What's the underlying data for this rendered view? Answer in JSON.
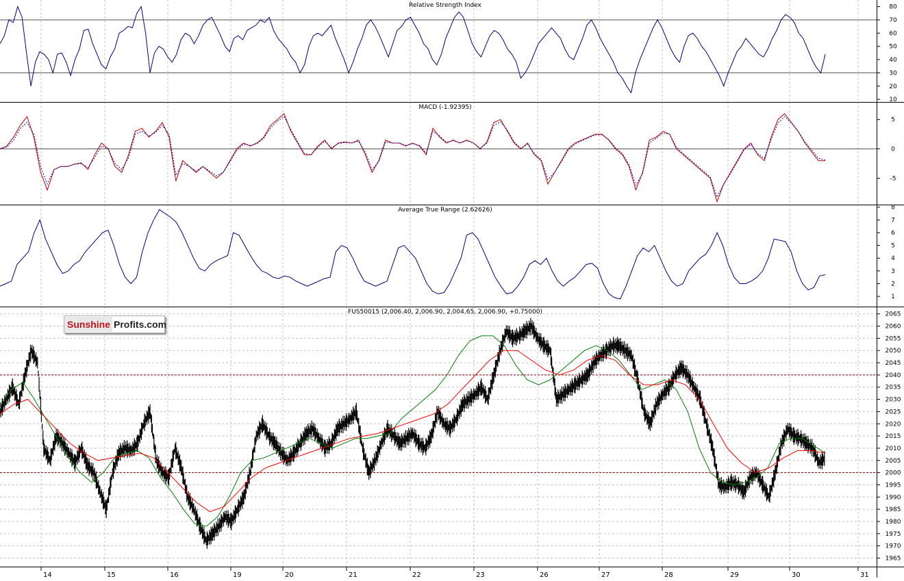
{
  "colors": {
    "rsi_line": "#000080",
    "macd_line": "#c00000",
    "signal_line": "#0000c0",
    "atr_line": "#000080",
    "price_bars": "#000000",
    "ma_fast": "#008000",
    "ma_slow": "#ff0000",
    "level_lines": "#800000",
    "grid": "#c0c0c0"
  },
  "logo": {
    "part1": "Sunshine",
    "part2": "Profits.com"
  },
  "x_axis": {
    "labels": [
      "14",
      "15",
      "16",
      "19",
      "20",
      "21",
      "22",
      "23",
      "26",
      "27",
      "28",
      "29",
      "30",
      "31"
    ]
  },
  "chart_data": [
    {
      "type": "line",
      "title": "Relative Strength Index",
      "ylim": [
        8,
        85
      ],
      "y_ticks": [
        80,
        70,
        60,
        50,
        40,
        30,
        20,
        10
      ],
      "reference_levels": [
        70,
        30
      ],
      "grid": true,
      "series": [
        {
          "key": "rsi",
          "style": "solid",
          "values": [
            52,
            58,
            70,
            68,
            80,
            72,
            45,
            20,
            38,
            46,
            44,
            40,
            30,
            44,
            45,
            38,
            28,
            40,
            48,
            62,
            63,
            52,
            44,
            36,
            33,
            42,
            48,
            60,
            62,
            65,
            64,
            75,
            80,
            60,
            30,
            45,
            50,
            48,
            42,
            38,
            44,
            55,
            60,
            58,
            52,
            58,
            66,
            70,
            72,
            65,
            58,
            50,
            46,
            56,
            58,
            55,
            62,
            64,
            66,
            70,
            68,
            72,
            62,
            56,
            52,
            48,
            42,
            38,
            30,
            36,
            50,
            58,
            60,
            58,
            62,
            66,
            56,
            48,
            40,
            30,
            38,
            48,
            56,
            66,
            70,
            65,
            58,
            50,
            42,
            52,
            62,
            65,
            70,
            72,
            66,
            60,
            52,
            48,
            40,
            36,
            44,
            56,
            64,
            72,
            76,
            72,
            62,
            52,
            46,
            42,
            50,
            58,
            62,
            60,
            55,
            48,
            44,
            38,
            26,
            30,
            36,
            44,
            52,
            56,
            60,
            64,
            60,
            56,
            48,
            42,
            40,
            48,
            56,
            66,
            70,
            64,
            56,
            50,
            44,
            38,
            30,
            26,
            20,
            15,
            30,
            40,
            48,
            56,
            64,
            70,
            64,
            56,
            48,
            42,
            38,
            50,
            58,
            60,
            56,
            50,
            46,
            40,
            34,
            28,
            20,
            30,
            38,
            46,
            50,
            56,
            52,
            48,
            44,
            42,
            48,
            56,
            62,
            70,
            74,
            72,
            68,
            60,
            56,
            48,
            40,
            34,
            30,
            44
          ]
        }
      ]
    },
    {
      "type": "line",
      "title": "MACD (-1.92395)",
      "ylim": [
        -9.5,
        8
      ],
      "y_ticks": [
        5,
        0,
        -5
      ],
      "reference_levels": [
        0
      ],
      "grid": true,
      "series": [
        {
          "key": "macd",
          "style": "solid",
          "values": [
            0,
            0.5,
            2,
            4,
            5.5,
            2,
            -4,
            -7,
            -3.5,
            -3,
            -3,
            -2.6,
            -2.4,
            -3.5,
            -1,
            1,
            0,
            -3,
            -4,
            -1,
            3,
            3.5,
            2,
            3,
            4.5,
            2,
            -5.5,
            -2,
            -3,
            -4,
            -3,
            -4,
            -5,
            -4,
            -2,
            0,
            1,
            0.5,
            1,
            2,
            4,
            5,
            6,
            3,
            1,
            -1,
            -1,
            0.5,
            1.5,
            0,
            1,
            1.2,
            1,
            1.5,
            -1,
            -4,
            -2,
            1.5,
            1,
            1,
            0.5,
            1,
            0.5,
            -1,
            3.5,
            2,
            1,
            1.5,
            1,
            1.5,
            1,
            0,
            1.2,
            4.5,
            5,
            3,
            1,
            0,
            1,
            -1,
            -2,
            -6,
            -4,
            -2,
            0,
            1,
            1.5,
            2,
            2.5,
            2.5,
            1.5,
            0,
            -1,
            -3,
            -7,
            -4,
            1.5,
            2,
            3,
            2.5,
            0,
            -1,
            -2,
            -3,
            -4,
            -5,
            -9,
            -6,
            -4,
            -2,
            0,
            1,
            -1,
            -2,
            2,
            5,
            6,
            4.5,
            3,
            1,
            -0.5,
            -2,
            -2
          ]
        },
        {
          "key": "signal",
          "style": "dashed",
          "values": [
            0,
            0.3,
            1.5,
            3.5,
            4.5,
            2.5,
            -3,
            -6,
            -3.5,
            -3,
            -3,
            -2.6,
            -2.5,
            -3.2,
            -1.5,
            0.5,
            0,
            -2.5,
            -3.5,
            -1.5,
            2.5,
            3,
            2.2,
            2.8,
            4,
            2.5,
            -4.5,
            -2.5,
            -3,
            -3.8,
            -3,
            -3.8,
            -4.6,
            -4,
            -2.2,
            -0.2,
            0.8,
            0.6,
            0.9,
            1.8,
            3.6,
            4.7,
            5.5,
            3.3,
            1.2,
            -0.8,
            -1,
            0.3,
            1.3,
            0.2,
            0.9,
            1.1,
            1,
            1.3,
            -0.6,
            -3.5,
            -2.2,
            1.2,
            1,
            1,
            0.6,
            0.9,
            0.6,
            -0.7,
            3,
            2.2,
            1.1,
            1.4,
            1,
            1.4,
            1,
            0.1,
            1,
            4,
            4.6,
            3.2,
            1.2,
            0.1,
            0.8,
            -0.8,
            -1.8,
            -5.2,
            -4,
            -2.2,
            -0.2,
            0.8,
            1.4,
            1.9,
            2.4,
            2.4,
            1.6,
            0.2,
            -0.8,
            -2.7,
            -6.2,
            -4.2,
            1,
            1.8,
            2.7,
            2.5,
            0.3,
            -0.8,
            -1.8,
            -2.8,
            -3.8,
            -4.8,
            -8.2,
            -6,
            -4.2,
            -2.2,
            -0.2,
            0.8,
            -0.8,
            -1.6,
            1.6,
            4.4,
            5.5,
            4.4,
            3,
            1.2,
            -0.2,
            -1.6,
            -1.9
          ]
        }
      ]
    },
    {
      "type": "line",
      "title": "Average True Range (2.62626)",
      "ylim": [
        0.2,
        8.2
      ],
      "y_ticks": [
        8,
        7,
        6,
        5,
        4,
        3,
        2,
        1
      ],
      "grid": true,
      "series": [
        {
          "key": "atr",
          "style": "solid",
          "values": [
            1.8,
            2,
            2.2,
            3.5,
            4,
            4.5,
            6,
            7,
            5.5,
            4.5,
            3.5,
            2.8,
            3,
            3.5,
            3.8,
            4.5,
            5,
            5.5,
            6,
            6.2,
            5,
            3.5,
            2.5,
            2,
            2.5,
            4.5,
            6,
            7,
            7.8,
            7.5,
            7.2,
            6.8,
            6,
            5,
            4,
            3.2,
            3,
            3.5,
            3.8,
            4,
            4.2,
            6,
            5.8,
            5,
            4.2,
            3.5,
            3,
            2.8,
            2.5,
            2.4,
            2.6,
            2.5,
            2.2,
            2,
            1.8,
            2,
            2.2,
            2.4,
            2.5,
            4.5,
            5,
            4.8,
            4,
            3,
            2.2,
            2,
            1.8,
            2,
            2.2,
            3.5,
            4.8,
            5,
            4.5,
            4,
            3,
            2,
            1.4,
            1.2,
            1.3,
            2,
            3,
            4,
            5.8,
            6,
            5.5,
            4.5,
            3.5,
            2.5,
            1.8,
            1.2,
            1.3,
            1.8,
            2.5,
            3.5,
            3.8,
            3.5,
            4,
            3,
            2.2,
            1.8,
            2.2,
            2.5,
            3,
            3.5,
            3.6,
            3.2,
            2,
            1.2,
            0.9,
            0.8,
            1.8,
            3,
            4.2,
            4.8,
            4.5,
            5,
            4,
            3,
            2.2,
            1.8,
            2,
            3,
            3.5,
            4,
            4.3,
            5,
            6,
            5,
            3.5,
            2.5,
            2,
            2,
            2.2,
            2.5,
            3,
            4,
            5.5,
            5.4,
            5.3,
            4.5,
            3,
            2,
            1.5,
            1.7,
            2.6,
            2.7
          ]
        }
      ]
    },
    {
      "type": "line",
      "title": "FUS50015 (2,006.40, 2,006.90, 2,004.65, 2,006.90, +0.75000)",
      "ylim": [
        1961.5,
        2068
      ],
      "y_ticks": [
        2065,
        2060,
        2055,
        2050,
        2045,
        2040,
        2035,
        2030,
        2025,
        2020,
        2015,
        2010,
        2005,
        2000,
        1995,
        1990,
        1985,
        1980,
        1975,
        1970,
        1965
      ],
      "reference_levels": [
        2040,
        2000
      ],
      "grid": true,
      "series": [
        {
          "key": "price",
          "style": "bars",
          "values": [
            2025,
            2030,
            2035,
            2028,
            2040,
            2050,
            2045,
            2010,
            2005,
            2015,
            2012,
            2008,
            2004,
            2010,
            2003,
            2000,
            1992,
            1985,
            2000,
            2008,
            2010,
            2009,
            2012,
            2020,
            2025,
            2005,
            2000,
            1998,
            2010,
            2002,
            1990,
            1985,
            1978,
            1972,
            1975,
            1978,
            1982,
            1980,
            1985,
            1990,
            2000,
            2015,
            2020,
            2015,
            2012,
            2008,
            2005,
            2008,
            2012,
            2016,
            2018,
            2014,
            2010,
            2012,
            2018,
            2020,
            2022,
            2025,
            2010,
            2000,
            2005,
            2012,
            2018,
            2015,
            2012,
            2014,
            2016,
            2012,
            2010,
            2015,
            2025,
            2020,
            2018,
            2022,
            2028,
            2030,
            2032,
            2035,
            2030,
            2040,
            2050,
            2058,
            2055,
            2056,
            2058,
            2060,
            2055,
            2052,
            2050,
            2030,
            2032,
            2034,
            2036,
            2038,
            2040,
            2045,
            2048,
            2050,
            2052,
            2052,
            2050,
            2048,
            2038,
            2025,
            2020,
            2028,
            2032,
            2035,
            2040,
            2043,
            2040,
            2035,
            2030,
            2020,
            2010,
            1995,
            1994,
            1996,
            1995,
            1992,
            1998,
            2000,
            1995,
            1990,
            2000,
            2012,
            2018,
            2015,
            2014,
            2012,
            2010,
            2004,
            2006
          ]
        },
        {
          "key": "ma_fast",
          "style": "solid",
          "values": [
            2028,
            2034,
            2037,
            2030,
            2022,
            2014,
            2006,
            2000,
            1996,
            2000,
            2006,
            2008,
            2009,
            2006,
            1998,
            1992,
            1985,
            1979,
            1978,
            1982,
            1990,
            2000,
            2005,
            2006,
            2008,
            2010,
            2012,
            2014,
            2012,
            2010,
            2012,
            2014,
            2014,
            2015,
            2016,
            2022,
            2026,
            2030,
            2034,
            2040,
            2048,
            2054,
            2056,
            2056,
            2052,
            2044,
            2038,
            2036,
            2038,
            2042,
            2046,
            2050,
            2052,
            2050,
            2046,
            2040,
            2034,
            2036,
            2038,
            2034,
            2025,
            2010,
            2000,
            1996,
            1995,
            1996,
            1998,
            2002,
            2012,
            2014,
            2014,
            2011,
            2008
          ]
        },
        {
          "key": "ma_slow",
          "style": "solid",
          "values": [
            2024,
            2028,
            2030,
            2024,
            2018,
            2012,
            2008,
            2005,
            2006,
            2007,
            2008,
            2006,
            2000,
            1994,
            1988,
            1984,
            1986,
            1992,
            1998,
            2002,
            2004,
            2006,
            2008,
            2010,
            2012,
            2014,
            2015,
            2016,
            2018,
            2020,
            2022,
            2024,
            2028,
            2034,
            2040,
            2046,
            2050,
            2050,
            2046,
            2042,
            2040,
            2042,
            2046,
            2048,
            2046,
            2040,
            2036,
            2036,
            2038,
            2036,
            2030,
            2020,
            2010,
            2004,
            2000,
            2002,
            2006,
            2009,
            2009,
            2008
          ]
        }
      ]
    }
  ]
}
